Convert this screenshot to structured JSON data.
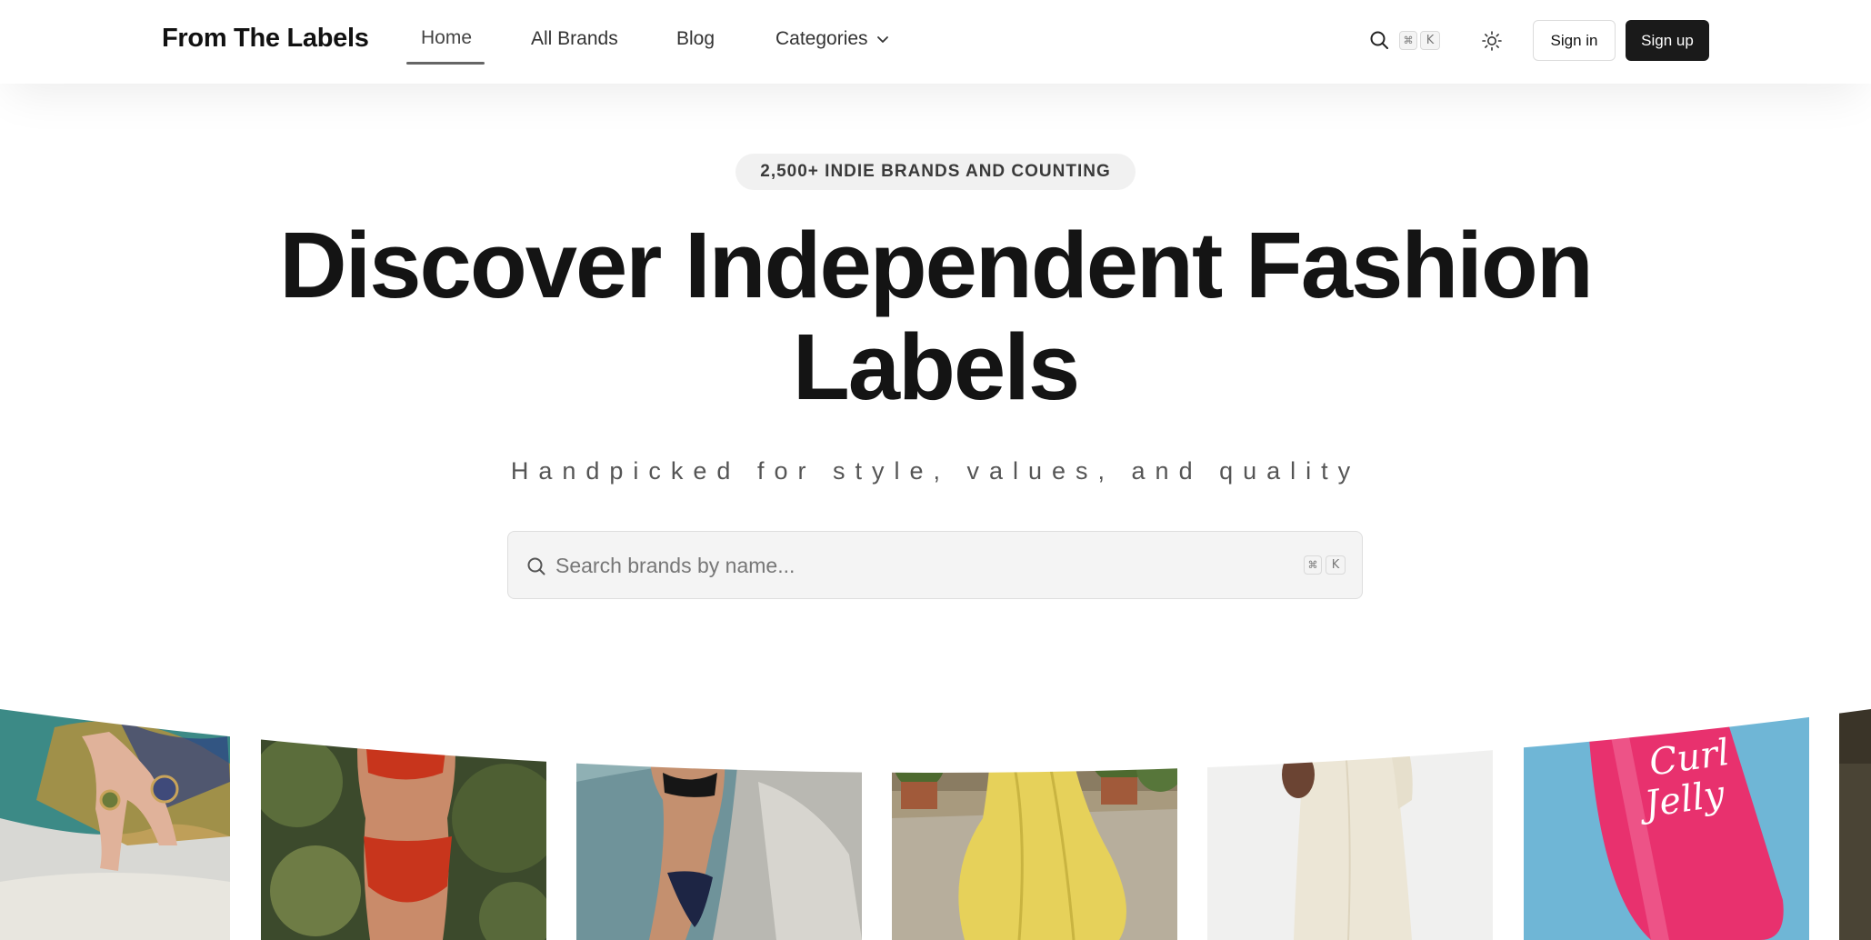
{
  "header": {
    "logo": "From The Labels",
    "nav": [
      {
        "label": "Home"
      },
      {
        "label": "All Brands"
      },
      {
        "label": "Blog"
      },
      {
        "label": "Categories"
      }
    ],
    "search_icon": "search-icon",
    "shortcut_keys": [
      "⌘",
      "K"
    ],
    "theme_icon": "sun-icon",
    "signin_label": "Sign in",
    "signup_label": "Sign up"
  },
  "hero": {
    "badge": "2,500+ INDIE BRANDS AND COUNTING",
    "title_line1": "Discover Independent Fashion",
    "title_line2": "Labels",
    "subtitle": "Handpicked for style, values, and quality",
    "search": {
      "placeholder": "Search brands by name...",
      "value": "",
      "shortcut_keys": [
        "⌘",
        "K"
      ]
    }
  },
  "gallery": {
    "items": [
      {
        "name": "jewelry-rings-photo",
        "bg": "#cfcfcf"
      },
      {
        "name": "red-bikini-photo",
        "bg": "#3e4a2e"
      },
      {
        "name": "black-bikini-photo",
        "bg": "#6a8d92"
      },
      {
        "name": "yellow-dress-photo",
        "bg": "#9a8a6f"
      },
      {
        "name": "cream-dress-photo",
        "bg": "#f1f1f1"
      },
      {
        "name": "curl-jelly-product-photo",
        "bg": "#76b9d8"
      },
      {
        "name": "partial-photo",
        "bg": "#4a4435"
      }
    ]
  },
  "colors": {
    "primary_button": "#1a1a1a",
    "text": "#141414",
    "badge_bg": "#f1f1f1",
    "search_bg": "#f4f4f4"
  }
}
